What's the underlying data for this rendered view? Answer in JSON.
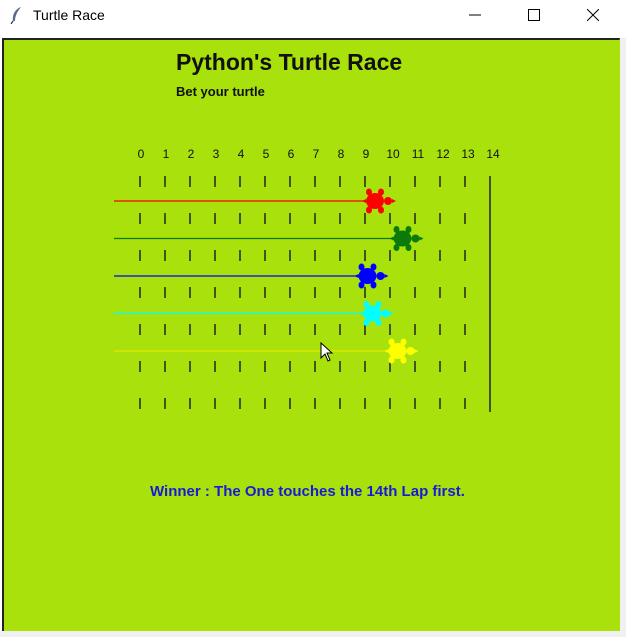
{
  "window": {
    "title": "Turtle Race",
    "icon": "feather-icon",
    "controls": [
      "minimize-icon",
      "maximize-icon",
      "close-icon"
    ]
  },
  "race": {
    "title": "Python's Turtle Race",
    "subtitle": "Bet your turtle",
    "lap_labels": [
      "0",
      "1",
      "2",
      "3",
      "4",
      "5",
      "6",
      "7",
      "8",
      "9",
      "10",
      "11",
      "12",
      "13",
      "14"
    ],
    "finish_lap": 14,
    "winner_text": "Winner : The One touches the 14th Lap first.",
    "winner_color": "#1a1ad6",
    "background": "#a8e10c",
    "turtles": [
      {
        "color": "red",
        "hex": "#ff0000",
        "position_lap": 9.4
      },
      {
        "color": "green",
        "hex": "#0a7a0a",
        "position_lap": 10.5
      },
      {
        "color": "blue",
        "hex": "#0000ff",
        "position_lap": 9.1
      },
      {
        "color": "cyan",
        "hex": "#00ffff",
        "position_lap": 9.3
      },
      {
        "color": "yellow",
        "hex": "#ffff00",
        "position_lap": 10.3
      }
    ]
  }
}
